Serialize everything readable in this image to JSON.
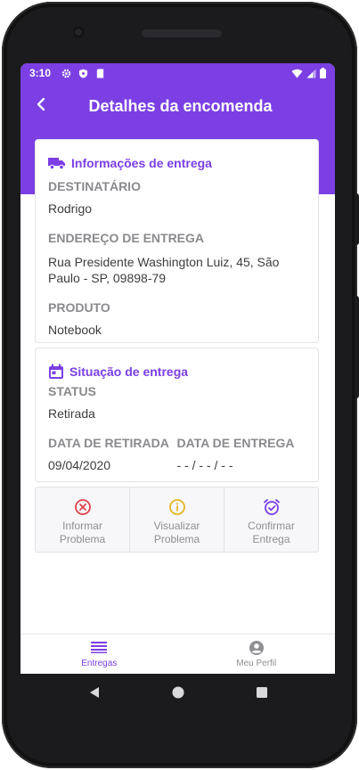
{
  "status_bar": {
    "time": "3:10"
  },
  "app_bar": {
    "title": "Detalhes da encomenda"
  },
  "delivery_info": {
    "section_title": "Informações de entrega",
    "recipient_label": "DESTINATÁRIO",
    "recipient_value": "Rodrigo",
    "address_label": "ENDEREÇO DE ENTREGA",
    "address_value": "Rua Presidente Washington Luiz, 45, São Paulo - SP, 09898-79",
    "product_label": "PRODUTO",
    "product_value": "Notebook"
  },
  "delivery_status": {
    "section_title": "Situação de entrega",
    "status_label": "STATUS",
    "status_value": "Retirada",
    "pickup_date_label": "DATA DE RETIRADA",
    "pickup_date_value": "09/04/2020",
    "delivery_date_label": "DATA DE ENTREGA",
    "delivery_date_value": "- - / - - / - -"
  },
  "actions": [
    {
      "label_line1": "Informar",
      "label_line2": "Problema",
      "icon": "x-circle-icon",
      "color": "#e0424b"
    },
    {
      "label_line1": "Visualizar",
      "label_line2": "Problema",
      "icon": "info-circle-icon",
      "color": "#e6b422"
    },
    {
      "label_line1": "Confirmar",
      "label_line2": "Entrega",
      "icon": "alarm-check-icon",
      "color": "#7b3fe4"
    }
  ],
  "bottom_nav": [
    {
      "label": "Entregas",
      "icon": "list-icon",
      "active": true
    },
    {
      "label": "Meu Perfil",
      "icon": "account-circle-icon",
      "active": false
    }
  ],
  "colors": {
    "primary": "#7b3fe4",
    "label_gray": "#8a8a8e",
    "text": "#3d3d40"
  }
}
